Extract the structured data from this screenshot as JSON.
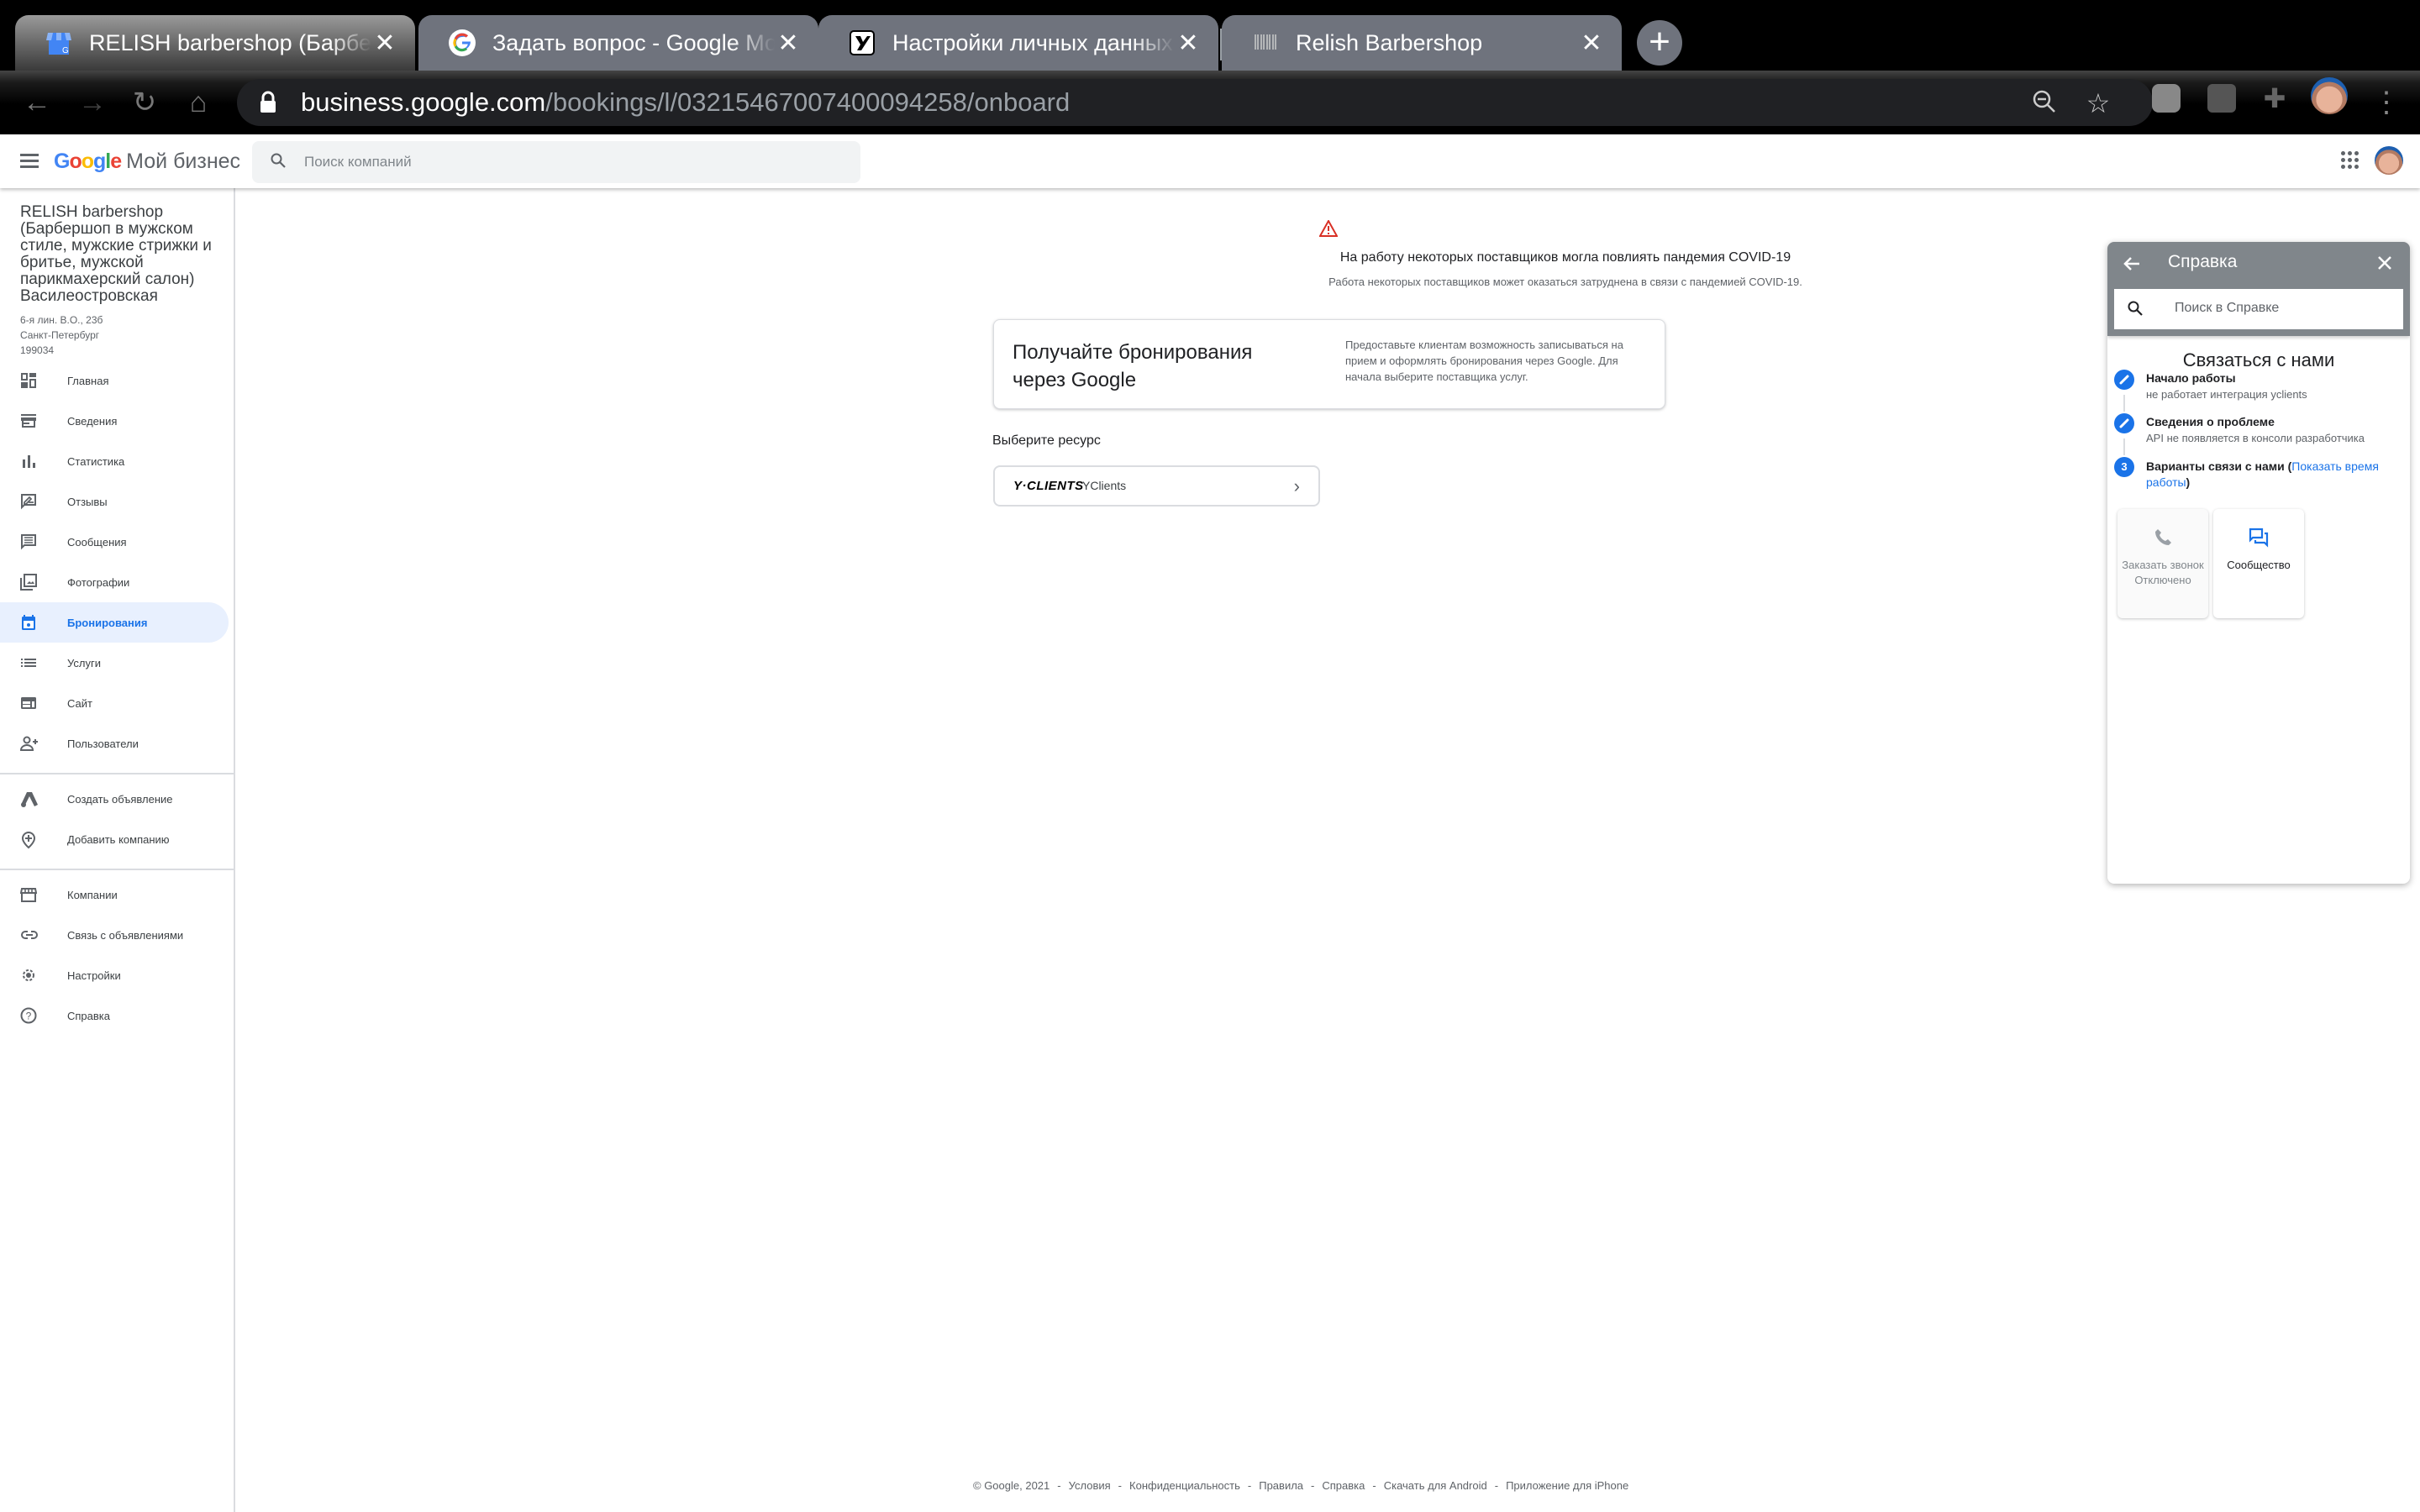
{
  "browser": {
    "tabs": [
      {
        "title": "RELISH barbershop (Барбершоп в мужском стиле",
        "favicon": "google-my-business-icon",
        "active": true
      },
      {
        "title": "Задать вопрос - Google Мой бизнес",
        "favicon": "google-g-icon",
        "active": false
      },
      {
        "title": "Настройки личных данных",
        "favicon": "yclients-y-icon",
        "active": false
      },
      {
        "title": "Relish Barbershop",
        "favicon": "relish-logo-icon",
        "active": false
      }
    ],
    "url_host": "business.google.com",
    "url_path": "/bookings/l/03215467007400094258/onboard",
    "close_glyph": "✕",
    "newtab_glyph": "+"
  },
  "appbar": {
    "logo_google": "Google",
    "logo_product": "Мой бизнес",
    "search_placeholder": "Поиск компаний"
  },
  "sidebar": {
    "business_name": "RELISH barbershop (Барбершоп в мужском стиле, мужские стрижки и бритье, мужской парикмахерский салон) Василеостровская",
    "address_lines": [
      "6-я лин. В.О., 23б",
      "Санкт-Петербург",
      "199034"
    ],
    "primary_items": [
      {
        "label": "Главная",
        "icon": "dashboard-icon"
      },
      {
        "label": "Сведения",
        "icon": "storefront-icon"
      },
      {
        "label": "Статистика",
        "icon": "bar-chart-icon"
      },
      {
        "label": "Отзывы",
        "icon": "rate-review-icon"
      },
      {
        "label": "Сообщения",
        "icon": "message-icon"
      },
      {
        "label": "Фотографии",
        "icon": "photo-library-icon"
      },
      {
        "label": "Бронирования",
        "icon": "calendar-icon",
        "active": true
      },
      {
        "label": "Услуги",
        "icon": "list-icon"
      },
      {
        "label": "Сайт",
        "icon": "web-icon"
      },
      {
        "label": "Пользователи",
        "icon": "person-add-icon"
      }
    ],
    "secondary_items": [
      {
        "label": "Создать объявление",
        "icon": "google-ads-icon"
      },
      {
        "label": "Добавить компанию",
        "icon": "add-location-icon"
      }
    ],
    "tertiary_items": [
      {
        "label": "Компании",
        "icon": "store-icon"
      },
      {
        "label": "Связь с объявлениями",
        "icon": "link-icon"
      },
      {
        "label": "Настройки",
        "icon": "settings-icon"
      },
      {
        "label": "Справка",
        "icon": "help-icon"
      }
    ]
  },
  "main": {
    "covid_title": "На работу некоторых поставщиков могла повлиять пандемия COVID-19",
    "covid_subtitle": "Работа некоторых поставщиков может оказаться затруднена в связи с пандемией COVID-19.",
    "card_heading": "Получайте бронирования через Google",
    "card_text": "Предоставьте клиентам возможность записываться на прием и оформлять бронирования через Google. Для начала выберите поставщика услуг.",
    "resource_label": "Выберите ресурс",
    "resource": {
      "brand": "Y·CLIENTS",
      "name": "YClients"
    },
    "warning_color": "#d93025"
  },
  "footer": {
    "items": [
      "© Google, 2021",
      "Условия",
      "Конфиденциальность",
      "Правила",
      "Справка",
      "Скачать для Android",
      "Приложение для iPhone"
    ],
    "separator": "-"
  },
  "help": {
    "title": "Справка",
    "search_placeholder": "Поиск в Справке",
    "contact_title": "Связаться с нами",
    "steps": [
      {
        "title": "Начало работы",
        "subtitle": "не работает интеграция yclients"
      },
      {
        "title": "Сведения о проблеме",
        "subtitle": "API не появляется в консоли разработчика"
      },
      {
        "number": "3",
        "title": "Варианты связи с нами",
        "link": "Показать время работы"
      }
    ],
    "options": [
      {
        "label": "Заказать звонок",
        "status": "Отключено",
        "icon": "phone-icon",
        "disabled": true
      },
      {
        "label": "Сообщество",
        "icon": "forum-icon",
        "disabled": false
      }
    ],
    "accent_color": "#1a73e8"
  }
}
